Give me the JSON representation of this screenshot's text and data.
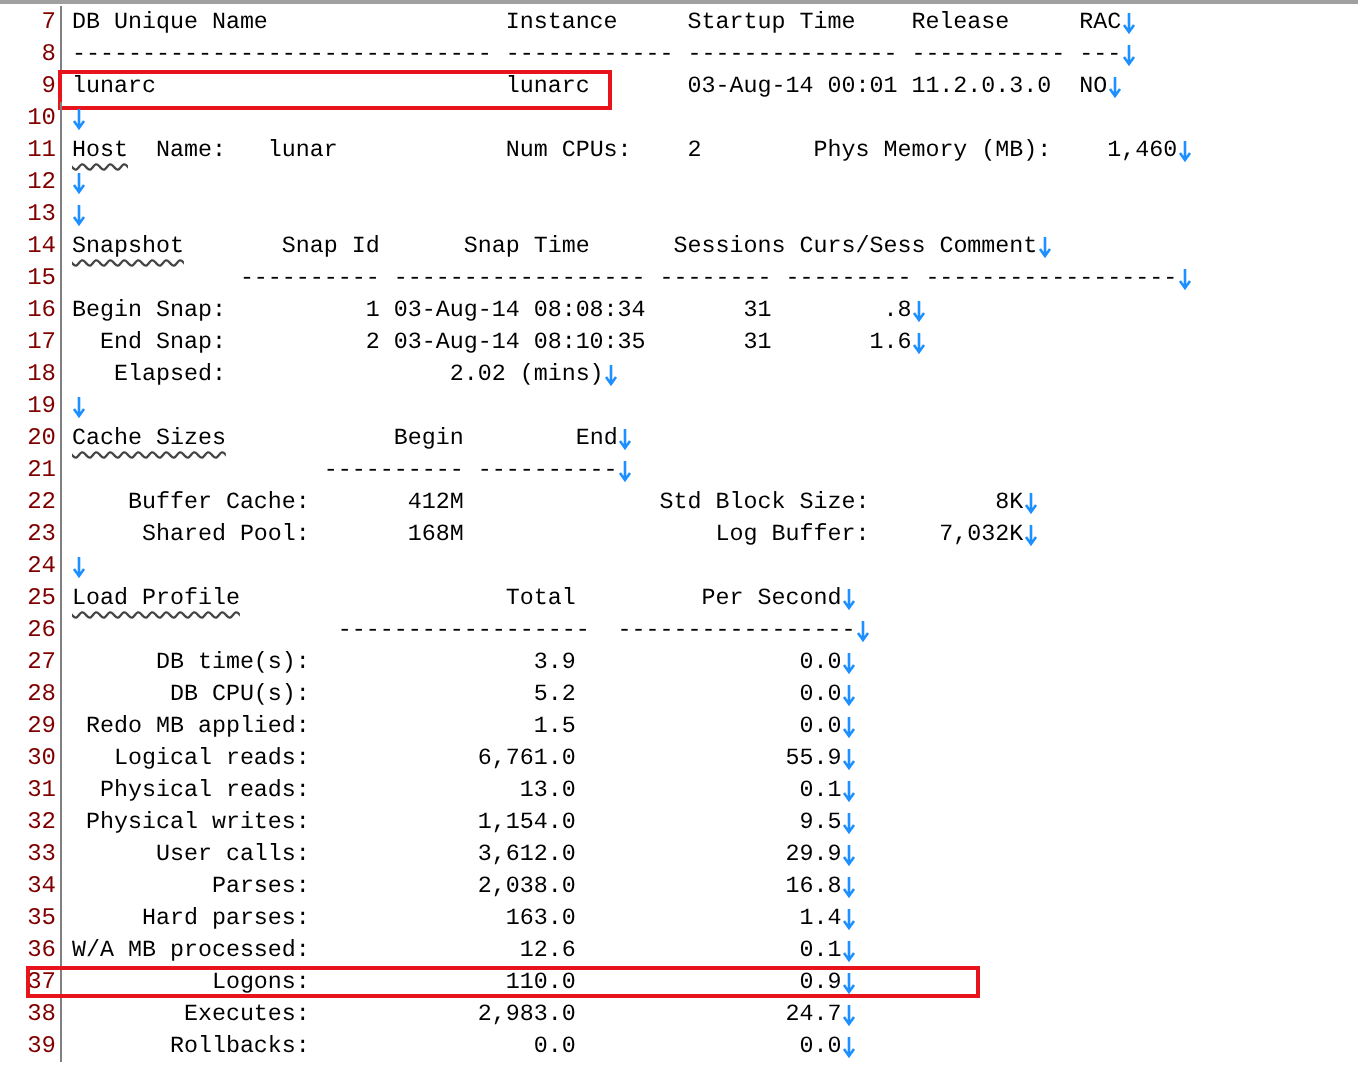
{
  "editor": {
    "lines": [
      {
        "number": "7",
        "eol": true,
        "boxed": false,
        "segments": [
          {
            "text": "DB Unique Name                 Instance     Startup Time    Release     RAC",
            "flagged": false
          }
        ]
      },
      {
        "number": "8",
        "eol": true,
        "boxed": false,
        "segments": [
          {
            "text": "------------------------------ ------------ --------------- ----------- ---",
            "flagged": false
          }
        ]
      },
      {
        "number": "9",
        "eol": true,
        "boxed": false,
        "segments": [
          {
            "text": "lunarc                         lunarc",
            "flagged": false,
            "boxed": true
          },
          {
            "text": "       03-Aug-14 00:01 11.2.0.3.0  NO",
            "flagged": false,
            "boxed": false
          }
        ]
      },
      {
        "number": "10",
        "eol": true,
        "boxed": false
      },
      {
        "number": "11",
        "eol": true,
        "boxed": false,
        "segments": [
          {
            "text": "Host",
            "flagged": true
          },
          {
            "text": "  Name:   lunar            Num CPUs:    2        Phys Memory (MB):    1,460",
            "flagged": false
          }
        ]
      },
      {
        "number": "12",
        "eol": true,
        "boxed": false
      },
      {
        "number": "13",
        "eol": true,
        "boxed": false
      },
      {
        "number": "14",
        "eol": true,
        "boxed": false,
        "segments": [
          {
            "text": "Snapshot",
            "flagged": true
          },
          {
            "text": "       Snap Id      Snap Time      Sessions Curs/Sess Comment",
            "flagged": false
          }
        ]
      },
      {
        "number": "15",
        "eol": true,
        "boxed": false,
        "segments": [
          {
            "text": "            ---------- ------------------ -------- --------- ------------------",
            "flagged": false
          }
        ]
      },
      {
        "number": "16",
        "eol": true,
        "boxed": false,
        "segments": [
          {
            "text": "Begin Snap:          1 03-Aug-14 08:08:34       31        .8",
            "flagged": false
          }
        ]
      },
      {
        "number": "17",
        "eol": true,
        "boxed": false,
        "segments": [
          {
            "text": "  End Snap:          2 03-Aug-14 08:10:35       31       1.6",
            "flagged": false
          }
        ]
      },
      {
        "number": "18",
        "eol": true,
        "boxed": false,
        "segments": [
          {
            "text": "   Elapsed:                2.02 (mins)",
            "flagged": false
          }
        ]
      },
      {
        "number": "19",
        "eol": true,
        "boxed": false
      },
      {
        "number": "20",
        "eol": true,
        "boxed": false,
        "segments": [
          {
            "text": "Cache Sizes",
            "flagged": true
          },
          {
            "text": "            Begin        End",
            "flagged": false
          }
        ]
      },
      {
        "number": "21",
        "eol": true,
        "boxed": false,
        "segments": [
          {
            "text": "                  ---------- ----------",
            "flagged": false
          }
        ]
      },
      {
        "number": "22",
        "eol": true,
        "boxed": false,
        "segments": [
          {
            "text": "    Buffer Cache:       412M              Std Block Size:         8K",
            "flagged": false
          }
        ]
      },
      {
        "number": "23",
        "eol": true,
        "boxed": false,
        "segments": [
          {
            "text": "     Shared Pool:       168M                  Log Buffer:     7,032K",
            "flagged": false
          }
        ]
      },
      {
        "number": "24",
        "eol": true,
        "boxed": false
      },
      {
        "number": "25",
        "eol": true,
        "boxed": false,
        "segments": [
          {
            "text": "Load Profile",
            "flagged": true
          },
          {
            "text": "                   Total         Per Second",
            "flagged": false
          }
        ]
      },
      {
        "number": "26",
        "eol": true,
        "boxed": false,
        "segments": [
          {
            "text": "                   ------------------  -----------------",
            "flagged": false
          }
        ]
      },
      {
        "number": "27",
        "eol": true,
        "boxed": false,
        "segments": [
          {
            "text": "      DB time(s):                3.9                0.0",
            "flagged": false
          }
        ]
      },
      {
        "number": "28",
        "eol": true,
        "boxed": false,
        "segments": [
          {
            "text": "       DB CPU(s):                5.2                0.0",
            "flagged": false
          }
        ]
      },
      {
        "number": "29",
        "eol": true,
        "boxed": false,
        "segments": [
          {
            "text": " Redo MB applied:                1.5                0.0",
            "flagged": false
          }
        ]
      },
      {
        "number": "30",
        "eol": true,
        "boxed": false,
        "segments": [
          {
            "text": "   Logical reads:            6,761.0               55.9",
            "flagged": false
          }
        ]
      },
      {
        "number": "31",
        "eol": true,
        "boxed": false,
        "segments": [
          {
            "text": "  Physical reads:               13.0                0.1",
            "flagged": false
          }
        ]
      },
      {
        "number": "32",
        "eol": true,
        "boxed": false,
        "segments": [
          {
            "text": " Physical writes:            1,154.0                9.5",
            "flagged": false
          }
        ]
      },
      {
        "number": "33",
        "eol": true,
        "boxed": false,
        "segments": [
          {
            "text": "      User calls:            3,612.0               29.9",
            "flagged": false
          }
        ]
      },
      {
        "number": "34",
        "eol": true,
        "boxed": false,
        "segments": [
          {
            "text": "          Parses:            2,038.0               16.8",
            "flagged": false
          }
        ]
      },
      {
        "number": "35",
        "eol": true,
        "boxed": false,
        "segments": [
          {
            "text": "     Hard parses:              163.0                1.4",
            "flagged": false
          }
        ]
      },
      {
        "number": "36",
        "eol": true,
        "boxed": false,
        "segments": [
          {
            "text": "W/A MB processed:               12.6                0.1",
            "flagged": false
          }
        ]
      },
      {
        "number": "37",
        "eol": true,
        "boxed": true,
        "segments": [
          {
            "text": "          Logons:              110.0                0.9",
            "flagged": false
          }
        ]
      },
      {
        "number": "38",
        "eol": true,
        "boxed": false,
        "segments": [
          {
            "text": "        Executes:            2,983.0               24.7",
            "flagged": false
          }
        ]
      },
      {
        "number": "39",
        "eol": true,
        "boxed": false,
        "segments": [
          {
            "text": "       Rollbacks:                0.0                0.0",
            "flagged": false
          }
        ]
      }
    ]
  }
}
